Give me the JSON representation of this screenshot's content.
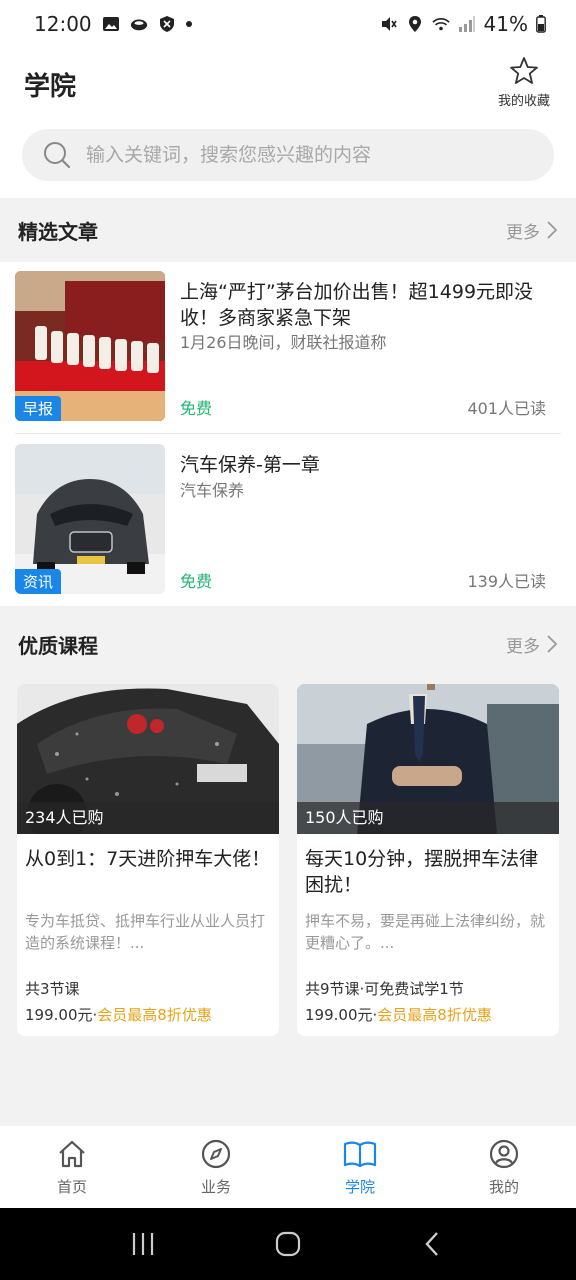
{
  "status_bar": {
    "time": "12:00",
    "battery": "41%"
  },
  "header": {
    "title": "学院",
    "favorites_label": "我的收藏"
  },
  "search": {
    "placeholder": "输入关键词，搜索您感兴趣的内容"
  },
  "articles_section": {
    "title": "精选文章",
    "more": "更多",
    "items": [
      {
        "title": "上海“严打”茅台加价出售！超1499元即没收！多商家紧急下架",
        "subtitle": "1月26日晚间，财联社报道称",
        "tag": "早报",
        "price": "免费",
        "reads": "401人已读"
      },
      {
        "title": "汽车保养-第一章",
        "subtitle": "汽车保养",
        "tag": "资讯",
        "price": "免费",
        "reads": "139人已读"
      }
    ]
  },
  "courses_section": {
    "title": "优质课程",
    "more": "更多",
    "items": [
      {
        "purchased": "234人已购",
        "title": "从0到1：7天进阶押车大佬！",
        "desc": "专为车抵贷、抵押车行业从业人员打造的系统课程！...",
        "lessons": "共3节课",
        "price": "199.00元",
        "sep": "·",
        "discount": "会员最高8折优惠"
      },
      {
        "purchased": "150人已购",
        "title": "每天10分钟，摆脱押车法律困扰！",
        "desc": "押车不易，要是再碰上法律纠纷，就更糟心了。...",
        "lessons": "共9节课·可免费试学1节",
        "price": "199.00元",
        "sep": "·",
        "discount": "会员最高8折优惠"
      }
    ]
  },
  "bottom_nav": {
    "items": [
      {
        "label": "首页",
        "icon": "home-icon"
      },
      {
        "label": "业务",
        "icon": "compass-icon"
      },
      {
        "label": "学院",
        "icon": "book-icon",
        "active": true
      },
      {
        "label": "我的",
        "icon": "user-icon"
      }
    ]
  },
  "colors": {
    "accent": "#1a86e8",
    "free": "#22b573",
    "discount": "#e8a31a"
  }
}
